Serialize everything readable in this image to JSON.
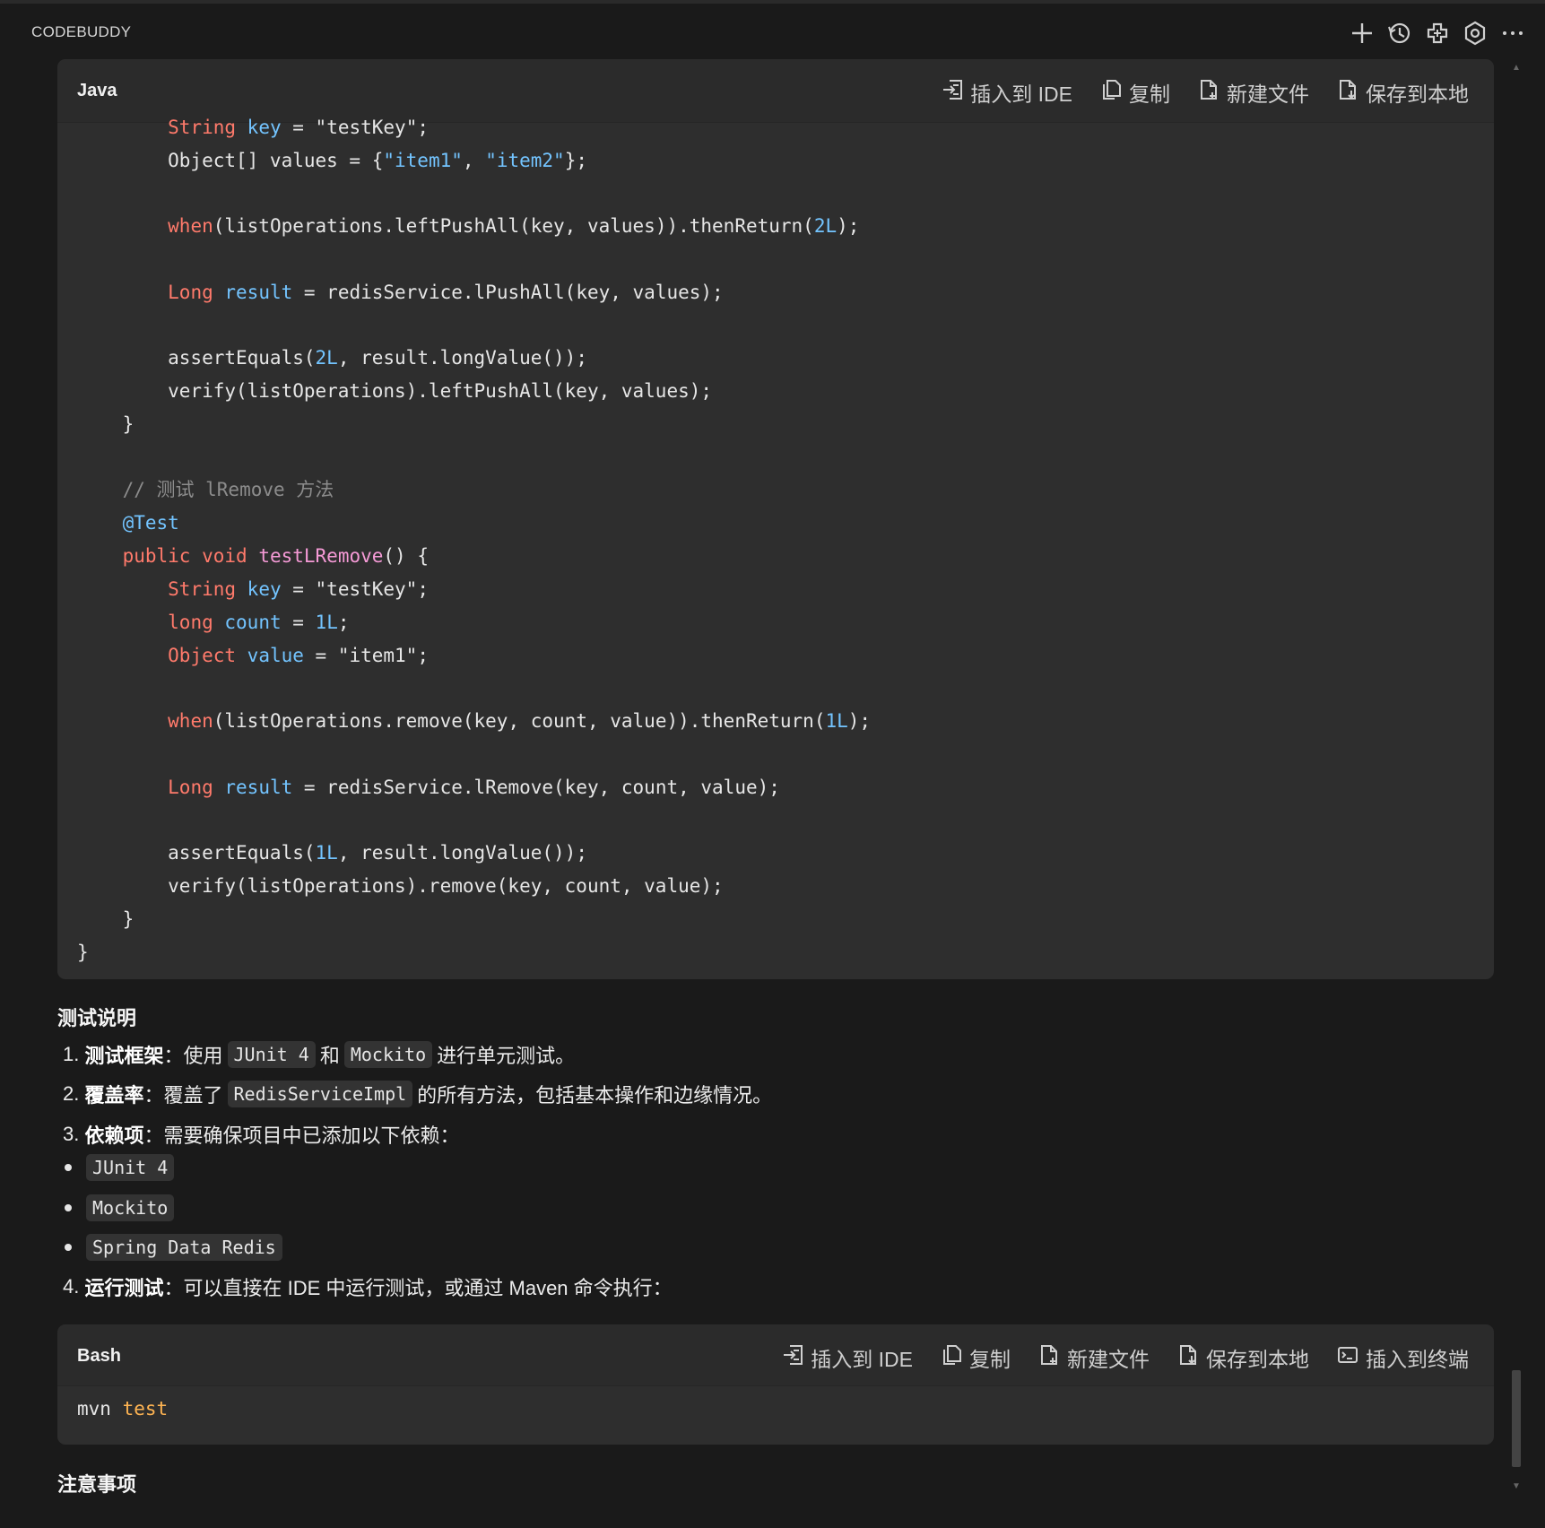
{
  "header": {
    "app_title": "CODEBUDDY",
    "icons": [
      "plus-icon",
      "history-icon",
      "extension-icon",
      "settings-icon",
      "more-icon"
    ]
  },
  "java_block": {
    "lang": "Java",
    "actions": [
      "插入到 IDE",
      "复制",
      "新建文件",
      "保存到本地"
    ]
  },
  "bash_block": {
    "lang": "Bash",
    "actions": [
      "插入到 IDE",
      "复制",
      "新建文件",
      "保存到本地",
      "插入到终端"
    ],
    "cmd": "mvn",
    "arg": "test"
  },
  "test_notes": {
    "title": "测试说明",
    "item1": {
      "num": "1.",
      "label": "测试框架",
      "t1": "：使用",
      "c1": "JUnit 4",
      "t2": "和",
      "c2": "Mockito",
      "t3": "进行单元测试。"
    },
    "item2": {
      "num": "2.",
      "label": "覆盖率",
      "t1": "：覆盖了",
      "c1": "RedisServiceImpl",
      "t2": "的所有方法，包括基本操作和边缘情况。"
    },
    "item3": {
      "num": "3.",
      "label": "依赖项",
      "t1": "：需要确保项目中已添加以下依赖："
    },
    "deps": [
      "JUnit 4",
      "Mockito",
      "Spring Data Redis"
    ],
    "item4": {
      "num": "4.",
      "label": "运行测试",
      "t1": "：可以直接在 IDE 中运行测试，或通过 Maven 命令执行："
    }
  },
  "notes_title": "注意事项",
  "colors": {
    "background": "#1a1a1a",
    "code_bg": "#2e2e2e",
    "keyword": "#ff7a6b",
    "identifier": "#73c4ff",
    "method": "#f59ad6"
  }
}
